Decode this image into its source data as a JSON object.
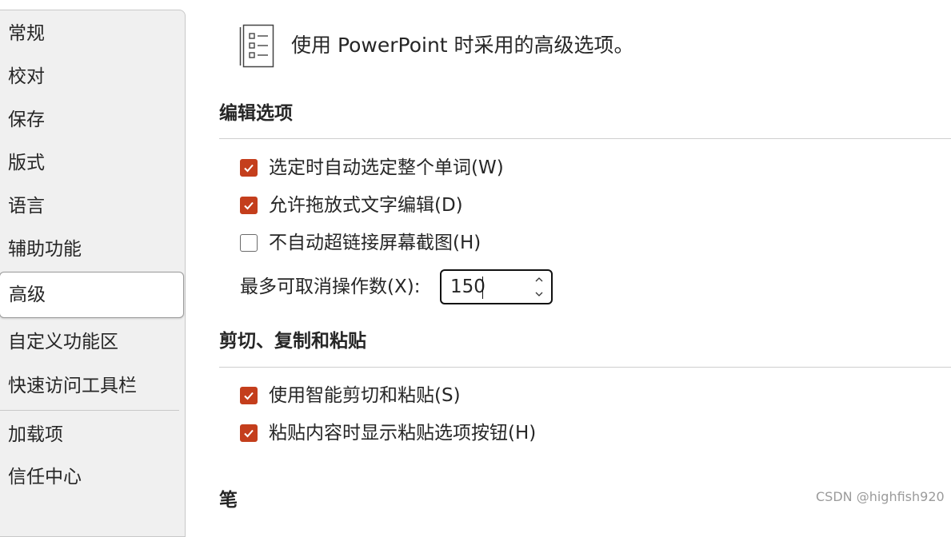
{
  "sidebar": {
    "items": [
      {
        "label": "常规"
      },
      {
        "label": "校对"
      },
      {
        "label": "保存"
      },
      {
        "label": "版式"
      },
      {
        "label": "语言"
      },
      {
        "label": "辅助功能"
      },
      {
        "label": "高级",
        "selected": true
      },
      {
        "label": "自定义功能区"
      },
      {
        "label": "快速访问工具栏"
      },
      {
        "label": "加载项"
      },
      {
        "label": "信任中心"
      }
    ]
  },
  "header": {
    "icon": "options-list-icon",
    "text": "使用 PowerPoint 时采用的高级选项。"
  },
  "sections": {
    "editing": {
      "title": "编辑选项",
      "options": [
        {
          "label": "选定时自动选定整个单词(W)",
          "checked": true
        },
        {
          "label": "允许拖放式文字编辑(D)",
          "checked": true
        },
        {
          "label": "不自动超链接屏幕截图(H)",
          "checked": false
        }
      ],
      "undo": {
        "label": "最多可取消操作数(X):",
        "value": "150"
      }
    },
    "clipboard": {
      "title": "剪切、复制和粘贴",
      "options": [
        {
          "label": "使用智能剪切和粘贴(S)",
          "checked": true
        },
        {
          "label": "粘贴内容时显示粘贴选项按钮(H)",
          "checked": true
        }
      ]
    },
    "pen": {
      "title": "笔"
    }
  },
  "watermark": "CSDN @highfish920",
  "colors": {
    "checkbox_checked": "#c43e1c",
    "sidebar_bg": "#f0f0f0"
  }
}
